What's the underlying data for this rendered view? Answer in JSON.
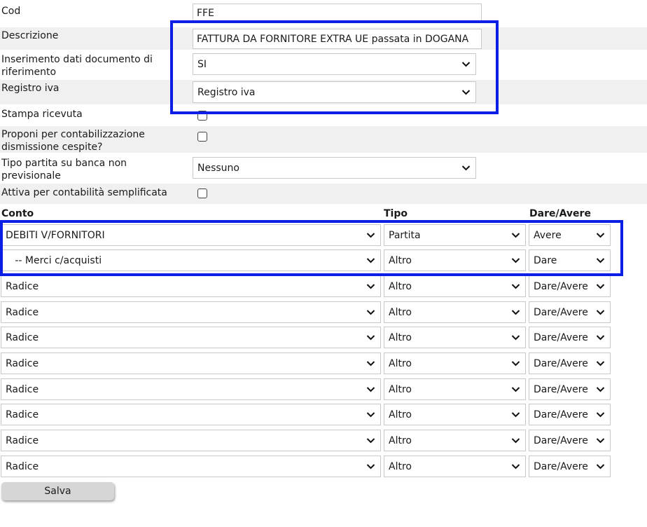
{
  "form": {
    "cod": {
      "label": "Cod",
      "value": "FFE"
    },
    "descrizione": {
      "label": "Descrizione",
      "value": "FATTURA DA FORNITORE EXTRA UE passata in DOGANA"
    },
    "inserimento": {
      "label_line1": "Inserimento dati documento di",
      "label_line2": "riferimento",
      "value": "SI"
    },
    "registro": {
      "label": "Registro iva",
      "value": "Registro iva"
    },
    "stampa": {
      "label": "Stampa ricevuta",
      "checked": false
    },
    "proponi": {
      "label_line1": "Proponi per contabilizzazione",
      "label_line2": "dismissione cespite?",
      "checked": false
    },
    "tipo_partita": {
      "label_line1": "Tipo partita su banca non",
      "label_line2": "previsionale",
      "value": "Nessuno"
    },
    "semplificata": {
      "label": "Attiva per contabilità semplificata",
      "checked": false
    }
  },
  "table": {
    "headers": {
      "conto": "Conto",
      "tipo": "Tipo",
      "dare_avere": "Dare/Avere"
    },
    "rows": [
      {
        "conto": "DEBITI V/FORNITORI",
        "tipo": "Partita",
        "dare_avere": "Avere"
      },
      {
        "conto": "   -- Merci c/acquisti",
        "tipo": "Altro",
        "dare_avere": "Dare"
      },
      {
        "conto": "Radice",
        "tipo": "Altro",
        "dare_avere": "Dare/Avere"
      },
      {
        "conto": "Radice",
        "tipo": "Altro",
        "dare_avere": "Dare/Avere"
      },
      {
        "conto": "Radice",
        "tipo": "Altro",
        "dare_avere": "Dare/Avere"
      },
      {
        "conto": "Radice",
        "tipo": "Altro",
        "dare_avere": "Dare/Avere"
      },
      {
        "conto": "Radice",
        "tipo": "Altro",
        "dare_avere": "Dare/Avere"
      },
      {
        "conto": "Radice",
        "tipo": "Altro",
        "dare_avere": "Dare/Avere"
      },
      {
        "conto": "Radice",
        "tipo": "Altro",
        "dare_avere": "Dare/Avere"
      },
      {
        "conto": "Radice",
        "tipo": "Altro",
        "dare_avere": "Dare/Avere"
      }
    ]
  },
  "actions": {
    "save_label": "Salva"
  },
  "icons": {
    "select": "chevron-down-icon"
  },
  "colors": {
    "highlight": "#0a1ee6",
    "row_shade": "#f0f0f0",
    "button": "#d6d6d6"
  }
}
